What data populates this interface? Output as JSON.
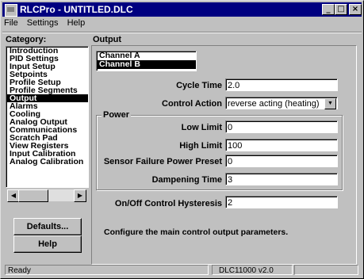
{
  "window": {
    "title": "RLCPro - UNTITLED.DLC",
    "buttons": {
      "minimize": "_",
      "maximize": "□",
      "close": "×"
    }
  },
  "menu": {
    "items": [
      "File",
      "Settings",
      "Help"
    ]
  },
  "category": {
    "label": "Category:",
    "items": [
      "Introduction",
      "PID Settings",
      "Input Setup",
      "Setpoints",
      "Profile Setup",
      "Profile Segments",
      "Output",
      "Alarms",
      "Cooling",
      "Analog Output",
      "Communications",
      "Scratch Pad",
      "View Registers",
      "Input Calibration",
      "Analog Calibration"
    ],
    "selected_index": 6
  },
  "left_buttons": {
    "defaults": "Defaults...",
    "help": "Help"
  },
  "output": {
    "label": "Output",
    "channels": [
      "Channel A",
      "Channel B"
    ],
    "selected_channel_index": 1,
    "cycle_time": {
      "label": "Cycle Time",
      "value": "2.0"
    },
    "control_action": {
      "label": "Control Action",
      "value": "reverse acting (heating)"
    },
    "power": {
      "label": "Power",
      "low_limit": {
        "label": "Low Limit",
        "value": "0"
      },
      "high_limit": {
        "label": "High Limit",
        "value": "100"
      },
      "sensor_failure": {
        "label": "Sensor Failure Power Preset",
        "value": "0"
      },
      "dampening": {
        "label": "Dampening Time",
        "value": "3"
      }
    },
    "hysteresis": {
      "label": "On/Off Control Hysteresis",
      "value": "2"
    },
    "description": "Configure the main control output parameters."
  },
  "status": {
    "left": "Ready",
    "version": "DLC11000 v2.0"
  }
}
